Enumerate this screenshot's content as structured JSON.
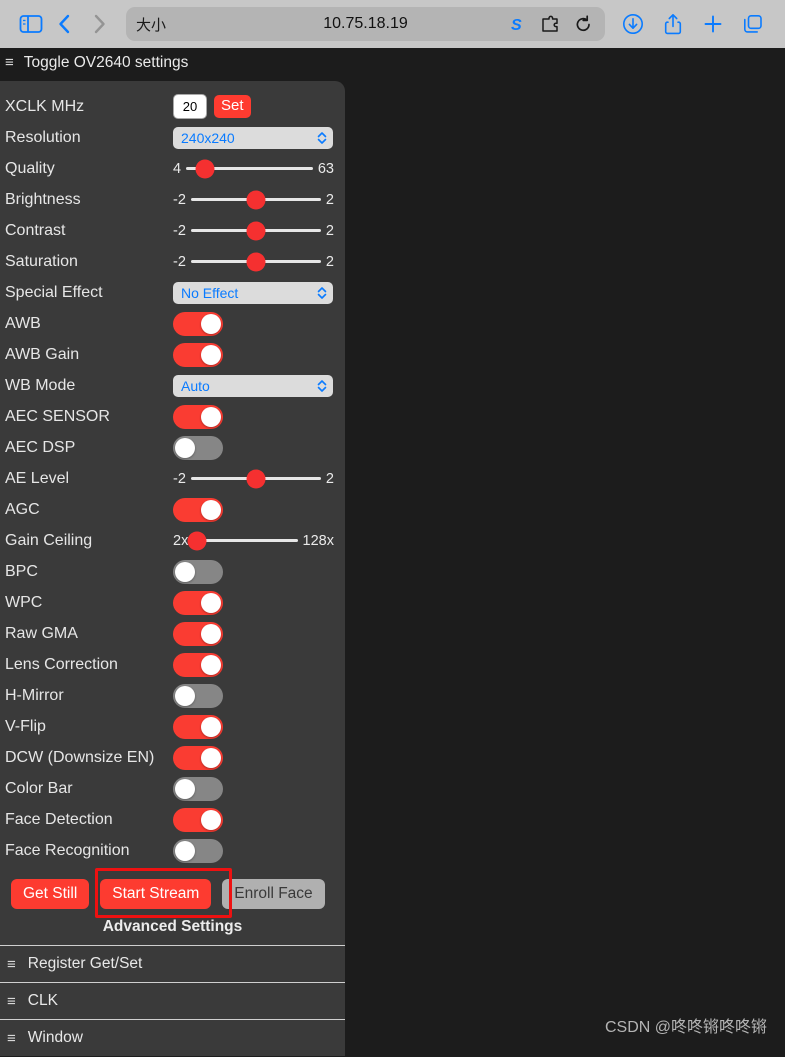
{
  "browser": {
    "sidebar_icon": "sidebar-icon",
    "back_icon": "chevron-left-icon",
    "forward_icon": "chevron-right-icon",
    "url_left_label": "大小",
    "url": "10.75.18.19",
    "reader_icon": "s-logo-icon",
    "extensions_icon": "puzzle-piece-icon",
    "reload_icon": "reload-icon",
    "download_icon": "download-icon",
    "share_icon": "share-icon",
    "new_tab_icon": "plus-icon",
    "tabs_icon": "tabs-icon"
  },
  "page_header": {
    "menu_icon": "hamburger-icon",
    "title": "Toggle OV2640 settings"
  },
  "settings": {
    "xclk": {
      "label": "XCLK MHz",
      "value": "20",
      "placeholder": "20",
      "set_label": "Set"
    },
    "rows": [
      {
        "type": "select",
        "label": "Resolution",
        "value": "240x240"
      },
      {
        "type": "slider",
        "label": "Quality",
        "min": "4",
        "max": "63",
        "pos": 15
      },
      {
        "type": "slider",
        "label": "Brightness",
        "min": "-2",
        "max": "2",
        "pos": 50
      },
      {
        "type": "slider",
        "label": "Contrast",
        "min": "-2",
        "max": "2",
        "pos": 50
      },
      {
        "type": "slider",
        "label": "Saturation",
        "min": "-2",
        "max": "2",
        "pos": 50
      },
      {
        "type": "select",
        "label": "Special Effect",
        "value": "No Effect"
      },
      {
        "type": "toggle",
        "label": "AWB",
        "on": true
      },
      {
        "type": "toggle",
        "label": "AWB Gain",
        "on": true
      },
      {
        "type": "select",
        "label": "WB Mode",
        "value": "Auto"
      },
      {
        "type": "toggle",
        "label": "AEC SENSOR",
        "on": true
      },
      {
        "type": "toggle",
        "label": "AEC DSP",
        "on": false
      },
      {
        "type": "slider",
        "label": "AE Level",
        "min": "-2",
        "max": "2",
        "pos": 50
      },
      {
        "type": "toggle",
        "label": "AGC",
        "on": true
      },
      {
        "type": "slider",
        "label": "Gain Ceiling",
        "min": "2x",
        "max": "128x",
        "pos": 4
      },
      {
        "type": "toggle",
        "label": "BPC",
        "on": false
      },
      {
        "type": "toggle",
        "label": "WPC",
        "on": true
      },
      {
        "type": "toggle",
        "label": "Raw GMA",
        "on": true
      },
      {
        "type": "toggle",
        "label": "Lens Correction",
        "on": true
      },
      {
        "type": "toggle",
        "label": "H-Mirror",
        "on": false
      },
      {
        "type": "toggle",
        "label": "V-Flip",
        "on": true
      },
      {
        "type": "toggle",
        "label": "DCW (Downsize EN)",
        "on": true
      },
      {
        "type": "toggle",
        "label": "Color Bar",
        "on": false
      },
      {
        "type": "toggle",
        "label": "Face Detection",
        "on": true
      },
      {
        "type": "toggle",
        "label": "Face Recognition",
        "on": false
      }
    ],
    "buttons": [
      {
        "label": "Get Still",
        "style": "primary"
      },
      {
        "label": "Start Stream",
        "style": "primary",
        "highlighted": true
      },
      {
        "label": "Enroll Face",
        "style": "disabled"
      }
    ],
    "advanced_title": "Advanced Settings",
    "sections": [
      {
        "label": "Register Get/Set"
      },
      {
        "label": "CLK"
      },
      {
        "label": "Window"
      }
    ]
  },
  "watermark": "CSDN @咚咚锵咚咚锵",
  "colors": {
    "accent_red": "#fd3b30",
    "toggle_on": "#fa3c32",
    "toggle_off": "#868686",
    "select_text": "#0a7bff",
    "panel_bg": "#3a3a3a",
    "page_bg": "#1c1c1c",
    "annotation": "#ee1111"
  }
}
